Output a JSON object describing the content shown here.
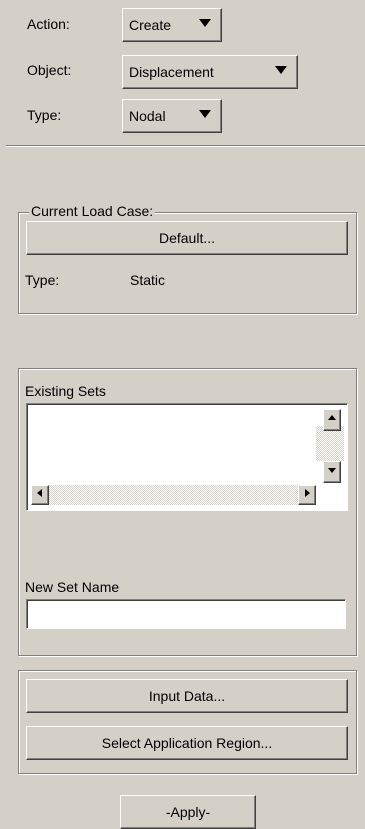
{
  "action": {
    "label": "Action:",
    "value": "Create"
  },
  "object": {
    "label": "Object:",
    "value": "Displacement"
  },
  "type": {
    "label": "Type:",
    "value": "Nodal"
  },
  "load_case": {
    "title": "Current Load Case:",
    "button": "Default...",
    "type_label": "Type:",
    "type_value": "Static"
  },
  "existing_sets": {
    "label": "Existing Sets"
  },
  "new_set": {
    "label": "New Set Name",
    "value": ""
  },
  "actions": {
    "input_data": "Input Data...",
    "select_region": "Select Application Region..."
  },
  "apply": "-Apply-"
}
